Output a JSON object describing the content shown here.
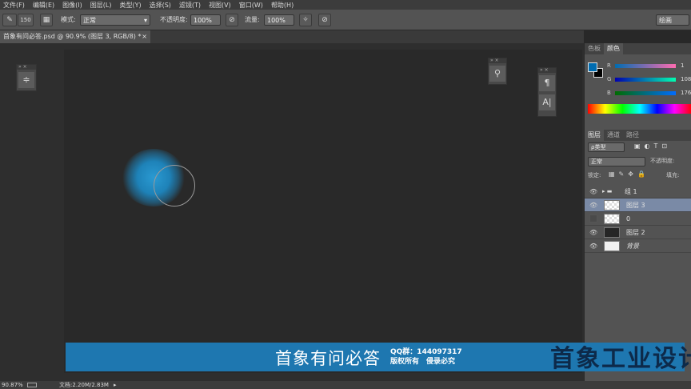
{
  "menu": [
    "文件(F)",
    "编辑(E)",
    "图像(I)",
    "图层(L)",
    "类型(Y)",
    "选择(S)",
    "滤镜(T)",
    "视图(V)",
    "窗口(W)",
    "帮助(H)"
  ],
  "options": {
    "brush_size": "150",
    "mode_label": "模式:",
    "mode_value": "正常",
    "opacity_label": "不透明度:",
    "opacity_value": "100%",
    "flow_label": "流量:",
    "flow_value": "100%",
    "workspace": "绘画"
  },
  "document_tab": "首象有问必答.psd @ 90.9% (图层 3, RGB/8) *",
  "color_panel": {
    "tabs": [
      "色板",
      "颜色"
    ],
    "channels": [
      {
        "label": "R",
        "value": "1"
      },
      {
        "label": "G",
        "value": "108"
      },
      {
        "label": "B",
        "value": "176"
      }
    ],
    "foreground_color": "#016cb0",
    "background_color": "#000000"
  },
  "layers_panel": {
    "tabs": [
      "图层",
      "通道",
      "路径"
    ],
    "filter": "ρ类型",
    "blend_mode": "正常",
    "opacity_label": "不透明度:",
    "lock_label": "锁定:",
    "fill_label": "填充:",
    "layers": [
      {
        "name": "组 1",
        "visible": true
      },
      {
        "name": "图层 3",
        "visible": true,
        "selected": true
      },
      {
        "name": "0",
        "visible": false
      },
      {
        "name": "图层 2",
        "visible": true
      },
      {
        "name": "背景",
        "visible": true
      }
    ]
  },
  "banner": {
    "brand": "首象有问必答",
    "qq": "QQ群：144097317",
    "rights": "版权所有　侵录必究"
  },
  "watermark": "首象工业设计",
  "status": {
    "zoom": "90.87%",
    "doc": "文档:2.20M/2.83M"
  }
}
